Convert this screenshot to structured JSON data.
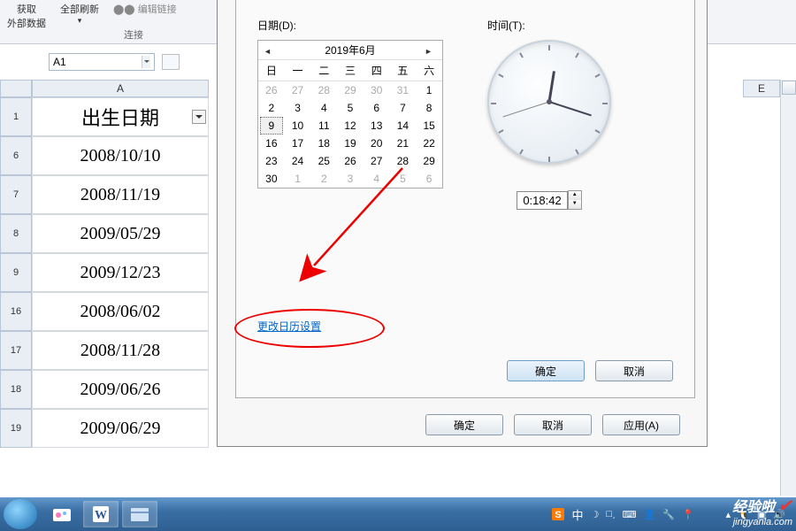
{
  "ribbon": {
    "get_data": "获取\n外部数据",
    "refresh": "全部刷新",
    "edit_links": "编辑链接",
    "group_label": "连接"
  },
  "namebox": {
    "value": "A1"
  },
  "columns": {
    "A": "A",
    "E": "E"
  },
  "rows": {
    "header_label": "出生日期",
    "data": [
      {
        "num": "1",
        "val": "出生日期",
        "is_header": true
      },
      {
        "num": "6",
        "val": "2008/10/10"
      },
      {
        "num": "7",
        "val": "2008/11/19"
      },
      {
        "num": "8",
        "val": "2009/05/29"
      },
      {
        "num": "9",
        "val": "2009/12/23"
      },
      {
        "num": "16",
        "val": "2008/06/02"
      },
      {
        "num": "17",
        "val": "2008/11/28"
      },
      {
        "num": "18",
        "val": "2009/06/26"
      },
      {
        "num": "19",
        "val": "2009/06/29"
      }
    ]
  },
  "dialog": {
    "date_label": "日期(D):",
    "time_label": "时间(T):",
    "cal_title": "2019年6月",
    "dow": [
      "日",
      "一",
      "二",
      "三",
      "四",
      "五",
      "六"
    ],
    "days": [
      {
        "d": "26",
        "o": true
      },
      {
        "d": "27",
        "o": true
      },
      {
        "d": "28",
        "o": true
      },
      {
        "d": "29",
        "o": true
      },
      {
        "d": "30",
        "o": true
      },
      {
        "d": "31",
        "o": true
      },
      {
        "d": "1"
      },
      {
        "d": "2"
      },
      {
        "d": "3"
      },
      {
        "d": "4"
      },
      {
        "d": "5"
      },
      {
        "d": "6"
      },
      {
        "d": "7"
      },
      {
        "d": "8"
      },
      {
        "d": "9",
        "sel": true
      },
      {
        "d": "10"
      },
      {
        "d": "11"
      },
      {
        "d": "12"
      },
      {
        "d": "13"
      },
      {
        "d": "14"
      },
      {
        "d": "15"
      },
      {
        "d": "16"
      },
      {
        "d": "17"
      },
      {
        "d": "18"
      },
      {
        "d": "19"
      },
      {
        "d": "20"
      },
      {
        "d": "21"
      },
      {
        "d": "22"
      },
      {
        "d": "23"
      },
      {
        "d": "24"
      },
      {
        "d": "25"
      },
      {
        "d": "26"
      },
      {
        "d": "27"
      },
      {
        "d": "28"
      },
      {
        "d": "29"
      },
      {
        "d": "30"
      },
      {
        "d": "1",
        "o": true
      },
      {
        "d": "2",
        "o": true
      },
      {
        "d": "3",
        "o": true
      },
      {
        "d": "4",
        "o": true
      },
      {
        "d": "5",
        "o": true
      },
      {
        "d": "6",
        "o": true
      }
    ],
    "time_value": "0:18:42",
    "change_cal": "更改日历设置",
    "ok": "确定",
    "cancel": "取消",
    "apply": "应用(A)"
  },
  "tray": {
    "ime": "中",
    "watermark_brand": "经验啦",
    "watermark_url": "jingyanla.com"
  }
}
